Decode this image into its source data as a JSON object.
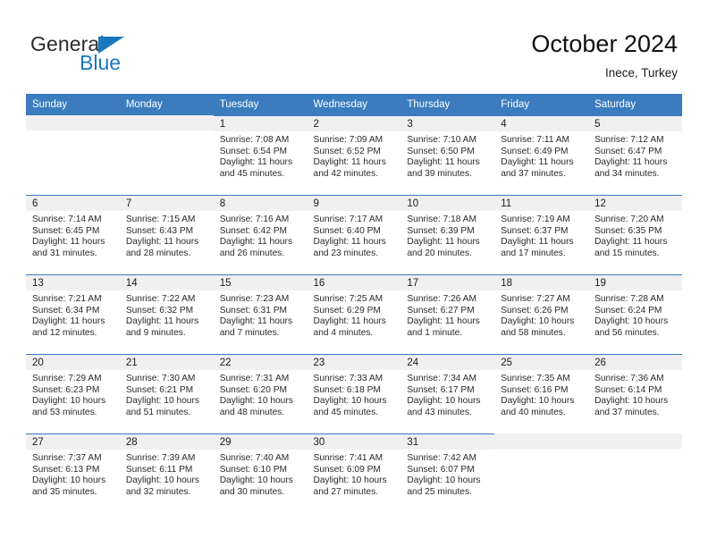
{
  "brand": {
    "word1": "General",
    "word2": "Blue",
    "triangle_color": "#1878be",
    "logo_icon": "triangle-flag-icon"
  },
  "header": {
    "title": "October 2024",
    "subtitle": "Inece, Turkey"
  },
  "theme": {
    "header_blue": "#3a7cbe",
    "daynum_band": "#f0f0f0",
    "text": "#2a2a2a"
  },
  "calendar": {
    "weekday_headers": [
      "Sunday",
      "Monday",
      "Tuesday",
      "Wednesday",
      "Thursday",
      "Friday",
      "Saturday"
    ],
    "labels": {
      "sunrise": "Sunrise:",
      "sunset": "Sunset:",
      "daylight": "Daylight:"
    },
    "weeks": [
      [
        {
          "day": "",
          "empty": true
        },
        {
          "day": "",
          "empty": true
        },
        {
          "day": "1",
          "sunrise": "Sunrise: 7:08 AM",
          "sunset": "Sunset: 6:54 PM",
          "daylight_line1": "Daylight: 11 hours",
          "daylight_line2": "and 45 minutes."
        },
        {
          "day": "2",
          "sunrise": "Sunrise: 7:09 AM",
          "sunset": "Sunset: 6:52 PM",
          "daylight_line1": "Daylight: 11 hours",
          "daylight_line2": "and 42 minutes."
        },
        {
          "day": "3",
          "sunrise": "Sunrise: 7:10 AM",
          "sunset": "Sunset: 6:50 PM",
          "daylight_line1": "Daylight: 11 hours",
          "daylight_line2": "and 39 minutes."
        },
        {
          "day": "4",
          "sunrise": "Sunrise: 7:11 AM",
          "sunset": "Sunset: 6:49 PM",
          "daylight_line1": "Daylight: 11 hours",
          "daylight_line2": "and 37 minutes."
        },
        {
          "day": "5",
          "sunrise": "Sunrise: 7:12 AM",
          "sunset": "Sunset: 6:47 PM",
          "daylight_line1": "Daylight: 11 hours",
          "daylight_line2": "and 34 minutes."
        }
      ],
      [
        {
          "day": "6",
          "sunrise": "Sunrise: 7:14 AM",
          "sunset": "Sunset: 6:45 PM",
          "daylight_line1": "Daylight: 11 hours",
          "daylight_line2": "and 31 minutes."
        },
        {
          "day": "7",
          "sunrise": "Sunrise: 7:15 AM",
          "sunset": "Sunset: 6:43 PM",
          "daylight_line1": "Daylight: 11 hours",
          "daylight_line2": "and 28 minutes."
        },
        {
          "day": "8",
          "sunrise": "Sunrise: 7:16 AM",
          "sunset": "Sunset: 6:42 PM",
          "daylight_line1": "Daylight: 11 hours",
          "daylight_line2": "and 26 minutes."
        },
        {
          "day": "9",
          "sunrise": "Sunrise: 7:17 AM",
          "sunset": "Sunset: 6:40 PM",
          "daylight_line1": "Daylight: 11 hours",
          "daylight_line2": "and 23 minutes."
        },
        {
          "day": "10",
          "sunrise": "Sunrise: 7:18 AM",
          "sunset": "Sunset: 6:39 PM",
          "daylight_line1": "Daylight: 11 hours",
          "daylight_line2": "and 20 minutes."
        },
        {
          "day": "11",
          "sunrise": "Sunrise: 7:19 AM",
          "sunset": "Sunset: 6:37 PM",
          "daylight_line1": "Daylight: 11 hours",
          "daylight_line2": "and 17 minutes."
        },
        {
          "day": "12",
          "sunrise": "Sunrise: 7:20 AM",
          "sunset": "Sunset: 6:35 PM",
          "daylight_line1": "Daylight: 11 hours",
          "daylight_line2": "and 15 minutes."
        }
      ],
      [
        {
          "day": "13",
          "sunrise": "Sunrise: 7:21 AM",
          "sunset": "Sunset: 6:34 PM",
          "daylight_line1": "Daylight: 11 hours",
          "daylight_line2": "and 12 minutes."
        },
        {
          "day": "14",
          "sunrise": "Sunrise: 7:22 AM",
          "sunset": "Sunset: 6:32 PM",
          "daylight_line1": "Daylight: 11 hours",
          "daylight_line2": "and 9 minutes."
        },
        {
          "day": "15",
          "sunrise": "Sunrise: 7:23 AM",
          "sunset": "Sunset: 6:31 PM",
          "daylight_line1": "Daylight: 11 hours",
          "daylight_line2": "and 7 minutes."
        },
        {
          "day": "16",
          "sunrise": "Sunrise: 7:25 AM",
          "sunset": "Sunset: 6:29 PM",
          "daylight_line1": "Daylight: 11 hours",
          "daylight_line2": "and 4 minutes."
        },
        {
          "day": "17",
          "sunrise": "Sunrise: 7:26 AM",
          "sunset": "Sunset: 6:27 PM",
          "daylight_line1": "Daylight: 11 hours",
          "daylight_line2": "and 1 minute."
        },
        {
          "day": "18",
          "sunrise": "Sunrise: 7:27 AM",
          "sunset": "Sunset: 6:26 PM",
          "daylight_line1": "Daylight: 10 hours",
          "daylight_line2": "and 58 minutes."
        },
        {
          "day": "19",
          "sunrise": "Sunrise: 7:28 AM",
          "sunset": "Sunset: 6:24 PM",
          "daylight_line1": "Daylight: 10 hours",
          "daylight_line2": "and 56 minutes."
        }
      ],
      [
        {
          "day": "20",
          "sunrise": "Sunrise: 7:29 AM",
          "sunset": "Sunset: 6:23 PM",
          "daylight_line1": "Daylight: 10 hours",
          "daylight_line2": "and 53 minutes."
        },
        {
          "day": "21",
          "sunrise": "Sunrise: 7:30 AM",
          "sunset": "Sunset: 6:21 PM",
          "daylight_line1": "Daylight: 10 hours",
          "daylight_line2": "and 51 minutes."
        },
        {
          "day": "22",
          "sunrise": "Sunrise: 7:31 AM",
          "sunset": "Sunset: 6:20 PM",
          "daylight_line1": "Daylight: 10 hours",
          "daylight_line2": "and 48 minutes."
        },
        {
          "day": "23",
          "sunrise": "Sunrise: 7:33 AM",
          "sunset": "Sunset: 6:18 PM",
          "daylight_line1": "Daylight: 10 hours",
          "daylight_line2": "and 45 minutes."
        },
        {
          "day": "24",
          "sunrise": "Sunrise: 7:34 AM",
          "sunset": "Sunset: 6:17 PM",
          "daylight_line1": "Daylight: 10 hours",
          "daylight_line2": "and 43 minutes."
        },
        {
          "day": "25",
          "sunrise": "Sunrise: 7:35 AM",
          "sunset": "Sunset: 6:16 PM",
          "daylight_line1": "Daylight: 10 hours",
          "daylight_line2": "and 40 minutes."
        },
        {
          "day": "26",
          "sunrise": "Sunrise: 7:36 AM",
          "sunset": "Sunset: 6:14 PM",
          "daylight_line1": "Daylight: 10 hours",
          "daylight_line2": "and 37 minutes."
        }
      ],
      [
        {
          "day": "27",
          "sunrise": "Sunrise: 7:37 AM",
          "sunset": "Sunset: 6:13 PM",
          "daylight_line1": "Daylight: 10 hours",
          "daylight_line2": "and 35 minutes."
        },
        {
          "day": "28",
          "sunrise": "Sunrise: 7:39 AM",
          "sunset": "Sunset: 6:11 PM",
          "daylight_line1": "Daylight: 10 hours",
          "daylight_line2": "and 32 minutes."
        },
        {
          "day": "29",
          "sunrise": "Sunrise: 7:40 AM",
          "sunset": "Sunset: 6:10 PM",
          "daylight_line1": "Daylight: 10 hours",
          "daylight_line2": "and 30 minutes."
        },
        {
          "day": "30",
          "sunrise": "Sunrise: 7:41 AM",
          "sunset": "Sunset: 6:09 PM",
          "daylight_line1": "Daylight: 10 hours",
          "daylight_line2": "and 27 minutes."
        },
        {
          "day": "31",
          "sunrise": "Sunrise: 7:42 AM",
          "sunset": "Sunset: 6:07 PM",
          "daylight_line1": "Daylight: 10 hours",
          "daylight_line2": "and 25 minutes."
        },
        {
          "day": "",
          "empty": true
        },
        {
          "day": "",
          "empty": true
        }
      ]
    ]
  }
}
